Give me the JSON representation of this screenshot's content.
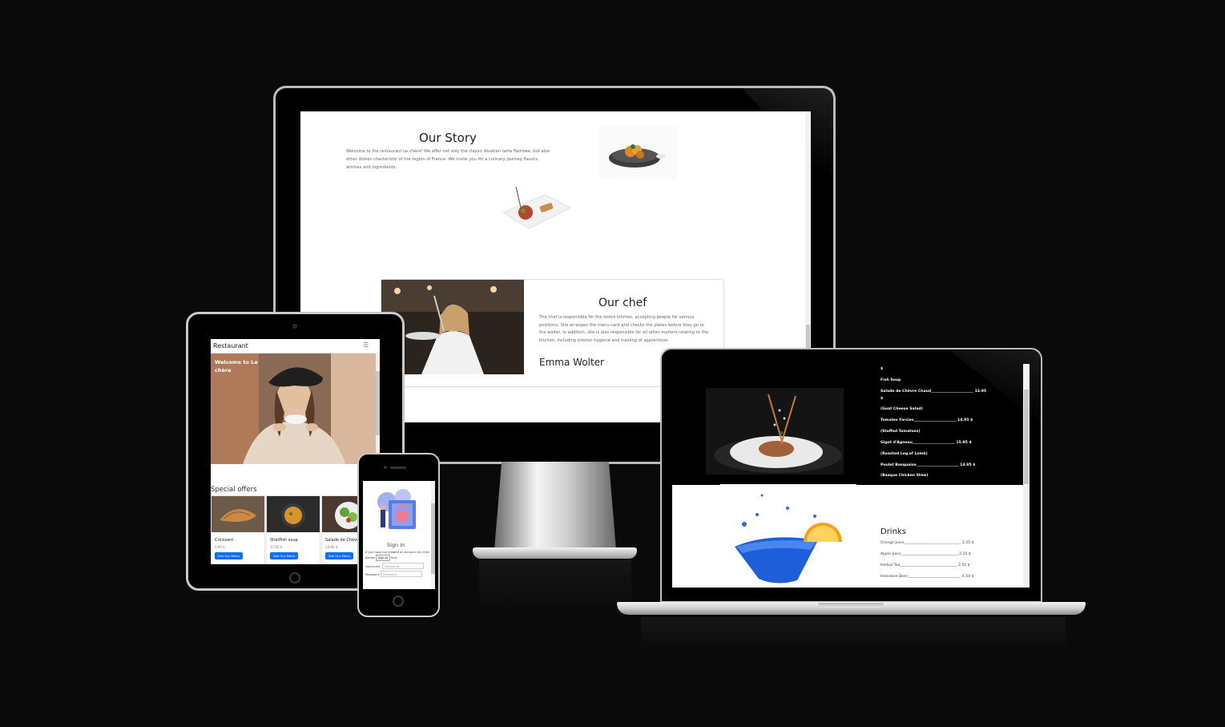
{
  "monitor": {
    "story_title": "Our Story",
    "story_text": "Welcome to the restaurant Le chère! We offer not only the classic Alsatian tarte flambée, but also other dishes chacteristic of the region of France. We invite you for a culinary journey flavors, aromas and ingredients.",
    "chef_title": "Our chef",
    "chef_text": "The chef is responsible for the entire kitchen, accepting people for various positions. She arranges the menu card and checks the plates before they go to the waiter. In addition, she is also responsible for all other matters relating to the kitchen, including interior hygiene and training of apprentices",
    "chef_name": "Emma Wolter"
  },
  "tablet": {
    "brand": "Restaurant",
    "menu_icon": "hamburger-icon",
    "hero_title": "Welcome to Le chère",
    "special_title": "Special offers",
    "cards": [
      {
        "name": "Croissant",
        "price": "3.95 $",
        "button": "See Our Menu"
      },
      {
        "name": "Shellfish soup",
        "price": "17.65 $",
        "button": "See Our Menu"
      },
      {
        "name": "Salade de Chèvre",
        "price": "13.95 $",
        "button": "See Our Menu"
      }
    ]
  },
  "phone": {
    "title": "Sign In",
    "text_before": "If you have not created an account yet, then please",
    "signup_button": "Sign up",
    "text_after": "first.",
    "username_label": "Username:",
    "username_placeholder": "Username",
    "password_label": "Password:",
    "password_placeholder": "Password"
  },
  "laptop": {
    "menu_rows": [
      {
        "name": "$",
        "price": ""
      },
      {
        "name": "Fish Soup",
        "price": ""
      },
      {
        "name": "Salade de Chèvre Chaud_______________________",
        "price": "13.95"
      },
      {
        "name": "$",
        "price": ""
      },
      {
        "name": "(Goat Cheese Salad)",
        "price": ""
      },
      {
        "name": "Tomates Farcies_______________________",
        "price": "14.95 $"
      },
      {
        "name": "(Stuffed Tomatoes)",
        "price": ""
      },
      {
        "name": "Gigot d'Agneau_______________________",
        "price": "15.95 $"
      },
      {
        "name": "(Roasted Leg of Lamb)",
        "price": ""
      },
      {
        "name": "Poulet Basquaise_______________________",
        "price": "14.95 $"
      },
      {
        "name": "(Basque Chicken Stew)",
        "price": ""
      }
    ],
    "drinks_title": "Drinks",
    "drinks": [
      {
        "name": "Orange Juice_______________________________",
        "price": "2.25 $"
      },
      {
        "name": "Apple Juice_______________________________",
        "price": "2.25 $"
      },
      {
        "name": "Herbal Tea_______________________________",
        "price": "2.50 $"
      },
      {
        "name": "Heineken Beer_____________________________",
        "price": "4.50 $"
      }
    ]
  }
}
